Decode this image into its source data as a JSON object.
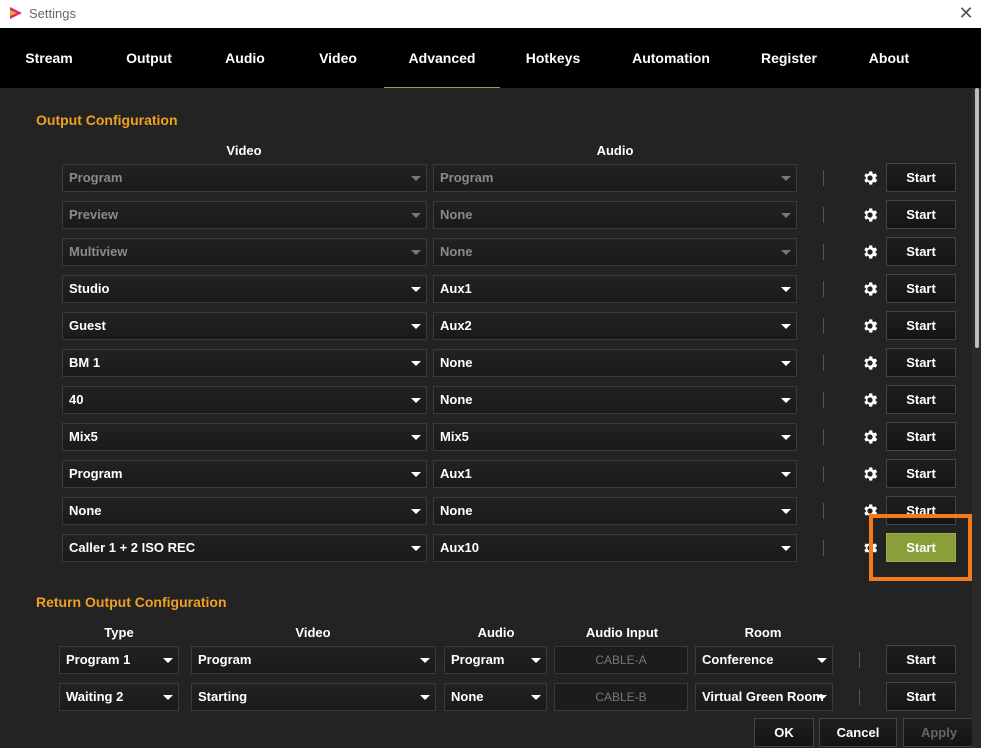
{
  "window": {
    "title": "Settings"
  },
  "tabs": [
    {
      "label": "Stream"
    },
    {
      "label": "Output"
    },
    {
      "label": "Audio"
    },
    {
      "label": "Video"
    },
    {
      "label": "Advanced"
    },
    {
      "label": "Hotkeys"
    },
    {
      "label": "Automation"
    },
    {
      "label": "Register"
    },
    {
      "label": "About"
    }
  ],
  "output_config": {
    "title": "Output Configuration",
    "video_header": "Video",
    "audio_header": "Audio",
    "rows": [
      {
        "video": "Program",
        "audio": "Program",
        "button": "Start"
      },
      {
        "video": "Preview",
        "audio": "None",
        "button": "Start"
      },
      {
        "video": "Multiview",
        "audio": "None",
        "button": "Start"
      },
      {
        "video": "Studio",
        "audio": "Aux1",
        "button": "Start"
      },
      {
        "video": "Guest",
        "audio": "Aux2",
        "button": "Start"
      },
      {
        "video": "BM 1",
        "audio": "None",
        "button": "Start"
      },
      {
        "video": "40",
        "audio": "None",
        "button": "Start"
      },
      {
        "video": "Mix5",
        "audio": "Mix5",
        "button": "Start"
      },
      {
        "video": "Program",
        "audio": "Aux1",
        "button": "Start"
      },
      {
        "video": "None",
        "audio": "None",
        "button": "Start"
      },
      {
        "video": "Caller 1 + 2 ISO REC",
        "audio": "Aux10",
        "button": "Start"
      }
    ]
  },
  "return_config": {
    "title": "Return Output Configuration",
    "headers": {
      "type": "Type",
      "video": "Video",
      "audio": "Audio",
      "audio_input": "Audio Input",
      "room": "Room"
    },
    "rows": [
      {
        "type": "Program 1",
        "video": "Program",
        "audio": "Program",
        "audio_input": "CABLE-A",
        "room": "Conference",
        "button": "Start"
      },
      {
        "type": "Waiting 2",
        "video": "Starting",
        "audio": "None",
        "audio_input": "CABLE-B",
        "room": "Virtual Green Room",
        "button": "Start"
      }
    ]
  },
  "footer": {
    "ok": "OK",
    "cancel": "Cancel",
    "apply": "Apply"
  },
  "colors": {
    "accent": "#f0a020",
    "active_button": "#8a9f3a",
    "highlight": "#f47a1a"
  }
}
